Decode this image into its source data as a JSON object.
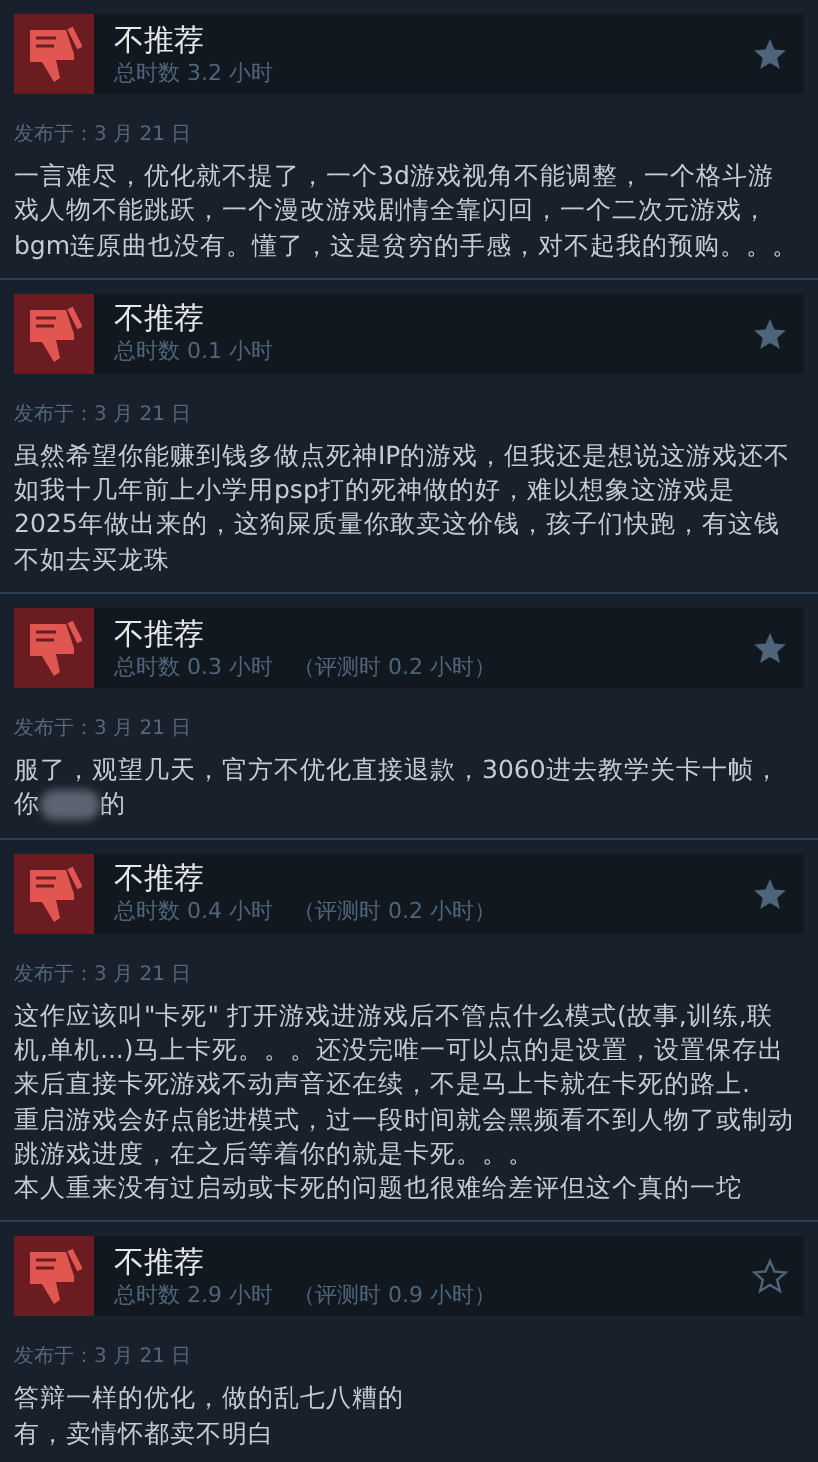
{
  "reviews": [
    {
      "verdict": "不推荐",
      "hours": "总时数 3.2 小时",
      "awarded": true,
      "date": "发布于：3 月 21 日",
      "lines": [
        "一言难尽，优化就不提了，一个3d游戏视角不能调整，一个格斗游",
        "戏人物不能跳跃，一个漫改游戏剧情全靠闪回，一个二次元游戏，",
        "bgm连原曲也没有。懂了，这是贫穷的手感，对不起我的预购。。。"
      ]
    },
    {
      "verdict": "不推荐",
      "hours": "总时数 0.1 小时",
      "awarded": true,
      "date": "发布于：3 月 21 日",
      "lines": [
        "虽然希望你能赚到钱多做点死神IP的游戏，但我还是想说这游戏还不",
        "如我十几年前上小学用psp打的死神做的好，难以想象这游戏是",
        "2025年做出来的，这狗屎质量你敢卖这价钱，孩子们快跑，有这钱",
        "不如去买龙珠"
      ]
    },
    {
      "verdict": "不推荐",
      "hours": "总时数 0.3 小时",
      "review_hours": "（评测时 0.2 小时）",
      "awarded": true,
      "date": "发布于：3 月 21 日",
      "lines": [
        "服了，观望几天，官方不优化直接退款，3060进去教学关卡十帧，",
        [
          "你",
          "的"
        ]
      ]
    },
    {
      "verdict": "不推荐",
      "hours": "总时数 0.4 小时",
      "review_hours": "（评测时 0.2 小时）",
      "awarded": true,
      "date": "发布于：3 月 21 日",
      "lines": [
        "这作应该叫\"卡死\" 打开游戏进游戏后不管点什么模式(故事,训练,联",
        "机,单机...)马上卡死。。。还没完唯一可以点的是设置，设置保存出",
        "来后直接卡死游戏不动声音还在续，不是马上卡就在卡死的路上.",
        "重启游戏会好点能进模式，过一段时间就会黑频看不到人物了或制动",
        "跳游戏进度，在之后等着你的就是卡死。。。",
        "本人重来没有过启动或卡死的问题也很难给差评但这个真的一坨"
      ]
    },
    {
      "verdict": "不推荐",
      "hours": "总时数 2.9 小时",
      "review_hours": "（评测时 0.9 小时）",
      "awarded": false,
      "date": "发布于：3 月 21 日",
      "lines": [
        "答辩一样的优化，做的乱七八糟的",
        "有，卖情怀都卖不明白"
      ]
    }
  ]
}
